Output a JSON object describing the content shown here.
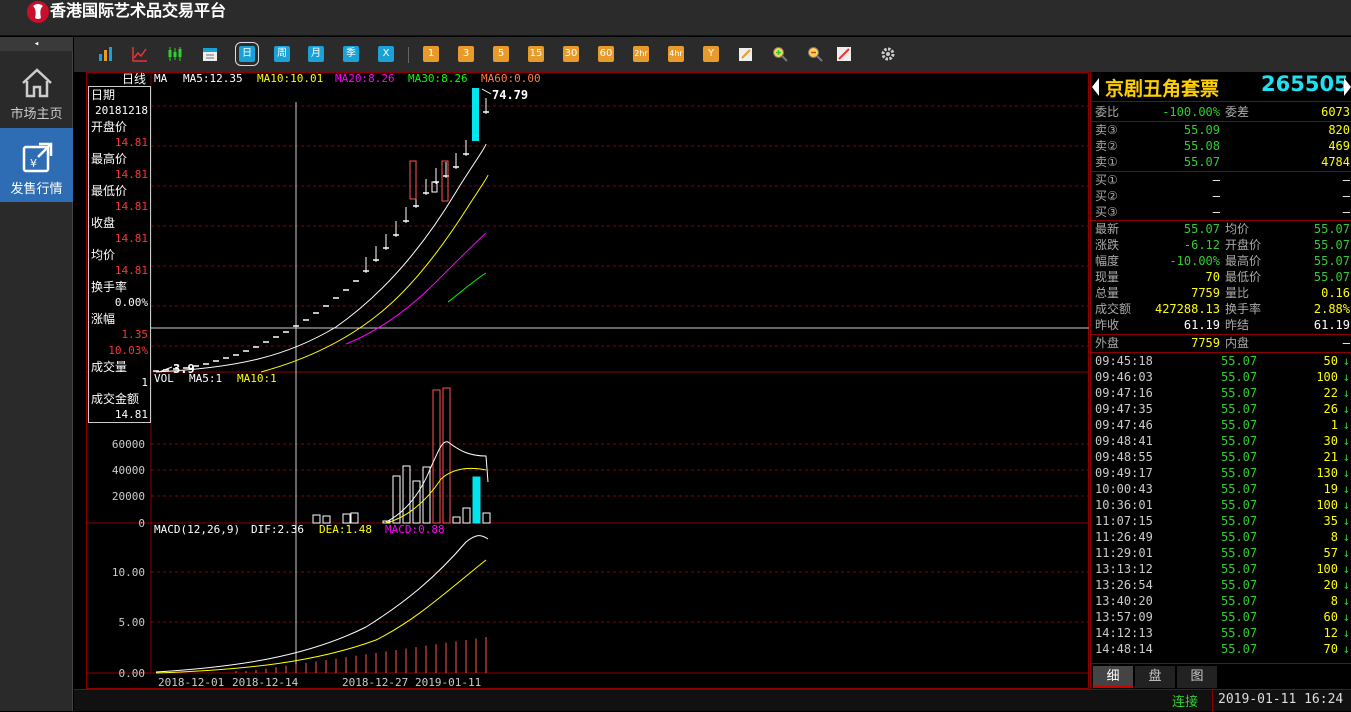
{
  "app": {
    "title": "香港国际艺术品交易平台"
  },
  "sidebar": {
    "collapse_glyph": "◂",
    "items": [
      {
        "label": "市场主页",
        "icon": "home-icon",
        "active": false
      },
      {
        "label": "发售行情",
        "icon": "issue-market-icon",
        "active": true
      }
    ]
  },
  "toolbar": {
    "chart_icons": [
      "bar-chart-icon",
      "line-chart-icon",
      "candlestick-icon",
      "calendar-icon"
    ],
    "periods": [
      {
        "label": "日",
        "color": "blue",
        "selected": true
      },
      {
        "label": "周",
        "color": "blue"
      },
      {
        "label": "月",
        "color": "blue"
      },
      {
        "label": "季",
        "color": "blue"
      },
      {
        "label": "X",
        "color": "blue"
      }
    ],
    "minutes": [
      "1",
      "3",
      "5",
      "15",
      "30",
      "60",
      "2hr",
      "4hr",
      "Y"
    ],
    "tools": [
      "edit-icon",
      "zoom-in-icon",
      "zoom-out-icon",
      "draw-icon",
      "settings-icon"
    ]
  },
  "chart": {
    "period_label": "日线",
    "ma_legend": [
      {
        "text": "MA",
        "color": "#ffffff"
      },
      {
        "text": "MA5:12.35",
        "color": "#ffffff"
      },
      {
        "text": "MA10:10.01",
        "color": "#ffff00"
      },
      {
        "text": "MA20:8.26",
        "color": "#ff00ff"
      },
      {
        "text": "MA30:8.26",
        "color": "#00ff00"
      },
      {
        "text": "MA60:0.00",
        "color": "#ff7f3f"
      }
    ],
    "price_high_label": "74.79",
    "price_low_label": "3.9",
    "vol_legend": [
      {
        "text": "VOL",
        "color": "#ffffff"
      },
      {
        "text": "MA5:1",
        "color": "#ffffff"
      },
      {
        "text": "MA10:1",
        "color": "#ffff00"
      }
    ],
    "vol_axis": [
      "60000",
      "40000",
      "20000",
      "0"
    ],
    "macd_legend": [
      {
        "text": "MACD(12,26,9)",
        "color": "#ffffff"
      },
      {
        "text": "DIF:2.36",
        "color": "#ffffff"
      },
      {
        "text": "DEA:1.48",
        "color": "#ffff00"
      },
      {
        "text": "MACD:0.88",
        "color": "#ff00ff"
      }
    ],
    "macd_axis": [
      "10.00",
      "5.00",
      "0.00"
    ],
    "date_labels": [
      "2018-12-01",
      "2018-12-14",
      "2018-12-27",
      "2019-01-11"
    ]
  },
  "infobox": {
    "rows": [
      {
        "label": "日期",
        "value": "20181218",
        "white": true
      },
      {
        "label": "开盘价",
        "value": "14.81"
      },
      {
        "label": "最高价",
        "value": "14.81"
      },
      {
        "label": "最低价",
        "value": "14.81"
      },
      {
        "label": "收盘",
        "value": "14.81"
      },
      {
        "label": "均价",
        "value": "14.81"
      },
      {
        "label": "换手率",
        "value": "0.00%",
        "white": true
      },
      {
        "label": "涨幅",
        "value": "1.35",
        "value2": "10.03%"
      },
      {
        "label": "成交量",
        "value": "1",
        "white": true
      },
      {
        "label": "成交金额",
        "value": "14.81",
        "white": true
      }
    ]
  },
  "quote": {
    "name": "京剧丑角套票",
    "code": "265505",
    "weibi": {
      "label": "委比",
      "value": "-100.00%",
      "label2": "委差",
      "value2": "6073"
    },
    "sells": [
      {
        "label": "卖③",
        "price": "55.09",
        "vol": "820"
      },
      {
        "label": "卖②",
        "price": "55.08",
        "vol": "469"
      },
      {
        "label": "卖①",
        "price": "55.07",
        "vol": "4784"
      }
    ],
    "buys": [
      {
        "label": "买①",
        "price": "—",
        "vol": "—"
      },
      {
        "label": "买②",
        "price": "—",
        "vol": "—"
      },
      {
        "label": "买③",
        "price": "—",
        "vol": "—"
      }
    ],
    "stats": [
      {
        "l1": "最新",
        "v1": "55.07",
        "c1": "green",
        "l2": "均价",
        "v2": "55.07",
        "c2": "green"
      },
      {
        "l1": "涨跌",
        "v1": "-6.12",
        "c1": "green",
        "l2": "开盘价",
        "v2": "55.07",
        "c2": "green"
      },
      {
        "l1": "幅度",
        "v1": "-10.00%",
        "c1": "green",
        "l2": "最高价",
        "v2": "55.07",
        "c2": "green"
      },
      {
        "l1": "现量",
        "v1": "70",
        "c1": "yellow",
        "l2": "最低价",
        "v2": "55.07",
        "c2": "green"
      },
      {
        "l1": "总量",
        "v1": "7759",
        "c1": "yellow",
        "l2": "量比",
        "v2": "0.16",
        "c2": "yellow"
      },
      {
        "l1": "成交额",
        "v1": "427288.13",
        "c1": "yellow",
        "l2": "换手率",
        "v2": "2.88%",
        "c2": "yellow"
      },
      {
        "l1": "昨收",
        "v1": "61.19",
        "c1": "white",
        "l2": "昨结",
        "v2": "61.19",
        "c2": "white"
      }
    ],
    "outer": {
      "label": "外盘",
      "value": "7759",
      "label2": "内盘",
      "value2": "—"
    },
    "ticks": [
      {
        "time": "09:45:18",
        "price": "55.07",
        "vol": "50"
      },
      {
        "time": "09:46:03",
        "price": "55.07",
        "vol": "100"
      },
      {
        "time": "09:47:16",
        "price": "55.07",
        "vol": "22"
      },
      {
        "time": "09:47:35",
        "price": "55.07",
        "vol": "26"
      },
      {
        "time": "09:47:46",
        "price": "55.07",
        "vol": "1"
      },
      {
        "time": "09:48:41",
        "price": "55.07",
        "vol": "30"
      },
      {
        "time": "09:48:55",
        "price": "55.07",
        "vol": "21"
      },
      {
        "time": "09:49:17",
        "price": "55.07",
        "vol": "130"
      },
      {
        "time": "10:00:43",
        "price": "55.07",
        "vol": "19"
      },
      {
        "time": "10:36:01",
        "price": "55.07",
        "vol": "100"
      },
      {
        "time": "11:07:15",
        "price": "55.07",
        "vol": "35"
      },
      {
        "time": "11:26:49",
        "price": "55.07",
        "vol": "8"
      },
      {
        "time": "11:29:01",
        "price": "55.07",
        "vol": "57"
      },
      {
        "time": "13:13:12",
        "price": "55.07",
        "vol": "100"
      },
      {
        "time": "13:26:54",
        "price": "55.07",
        "vol": "20"
      },
      {
        "time": "13:40:20",
        "price": "55.07",
        "vol": "8"
      },
      {
        "time": "13:57:09",
        "price": "55.07",
        "vol": "60"
      },
      {
        "time": "14:12:13",
        "price": "55.07",
        "vol": "12"
      },
      {
        "time": "14:48:14",
        "price": "55.07",
        "vol": "70"
      }
    ],
    "tick_arrow": "↓",
    "tabs": [
      {
        "label": "细",
        "active": true
      },
      {
        "label": "盘",
        "active": false
      },
      {
        "label": "图",
        "active": false
      }
    ]
  },
  "status": {
    "connection": "连接",
    "datetime": "2019-01-11  16:24"
  }
}
